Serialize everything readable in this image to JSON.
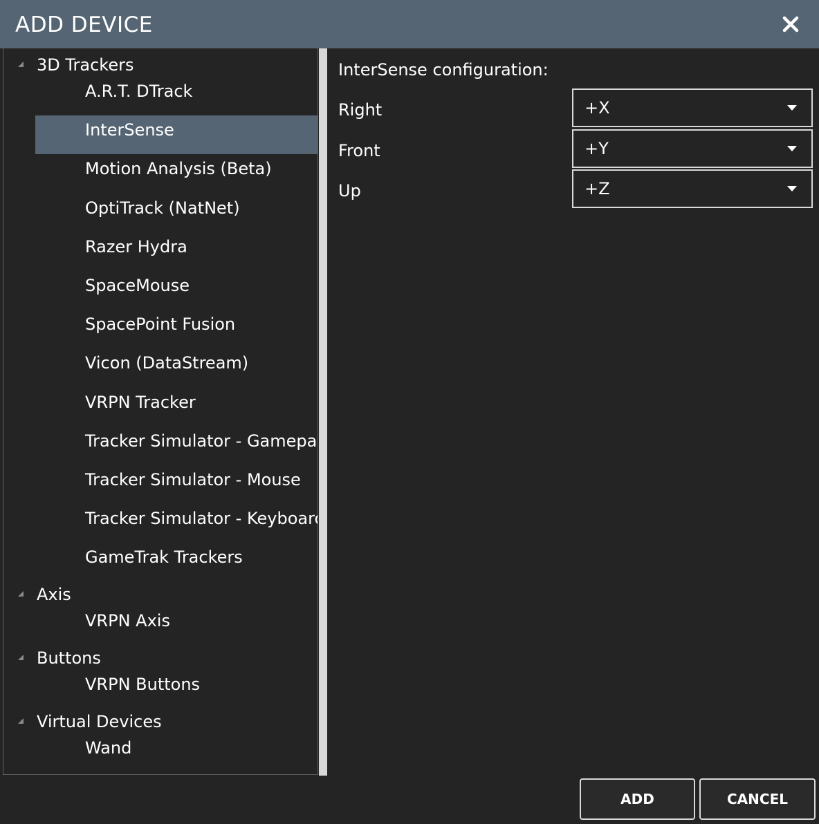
{
  "window": {
    "title": "ADD DEVICE",
    "close_icon": "close-icon"
  },
  "tree": {
    "categories": [
      {
        "label": "3D Trackers",
        "expanded": true,
        "items": [
          {
            "label": "A.R.T. DTrack",
            "selected": false
          },
          {
            "label": "InterSense",
            "selected": true
          },
          {
            "label": "Motion Analysis (Beta)",
            "selected": false
          },
          {
            "label": "OptiTrack (NatNet)",
            "selected": false
          },
          {
            "label": "Razer Hydra",
            "selected": false
          },
          {
            "label": "SpaceMouse",
            "selected": false
          },
          {
            "label": "SpacePoint Fusion",
            "selected": false
          },
          {
            "label": "Vicon (DataStream)",
            "selected": false
          },
          {
            "label": "VRPN Tracker",
            "selected": false
          },
          {
            "label": "Tracker Simulator - Gamepad",
            "selected": false
          },
          {
            "label": "Tracker Simulator - Mouse",
            "selected": false
          },
          {
            "label": "Tracker Simulator - Keyboard",
            "selected": false
          },
          {
            "label": "GameTrak Trackers",
            "selected": false
          }
        ]
      },
      {
        "label": "Axis",
        "expanded": true,
        "items": [
          {
            "label": "VRPN Axis",
            "selected": false
          }
        ]
      },
      {
        "label": "Buttons",
        "expanded": true,
        "items": [
          {
            "label": "VRPN Buttons",
            "selected": false
          }
        ]
      },
      {
        "label": "Virtual Devices",
        "expanded": true,
        "items": [
          {
            "label": "Wand",
            "selected": false
          }
        ]
      }
    ]
  },
  "config": {
    "title": "InterSense configuration:",
    "axes": [
      {
        "label": "Right",
        "value": "+X"
      },
      {
        "label": "Front",
        "value": "+Y"
      },
      {
        "label": "Up",
        "value": "+Z"
      }
    ]
  },
  "footer": {
    "add_label": "ADD",
    "cancel_label": "CANCEL"
  },
  "colors": {
    "titlebar": "#566573",
    "background": "#242424",
    "selection": "#566573",
    "border": "#d9d9d9",
    "text": "#ffffff"
  }
}
